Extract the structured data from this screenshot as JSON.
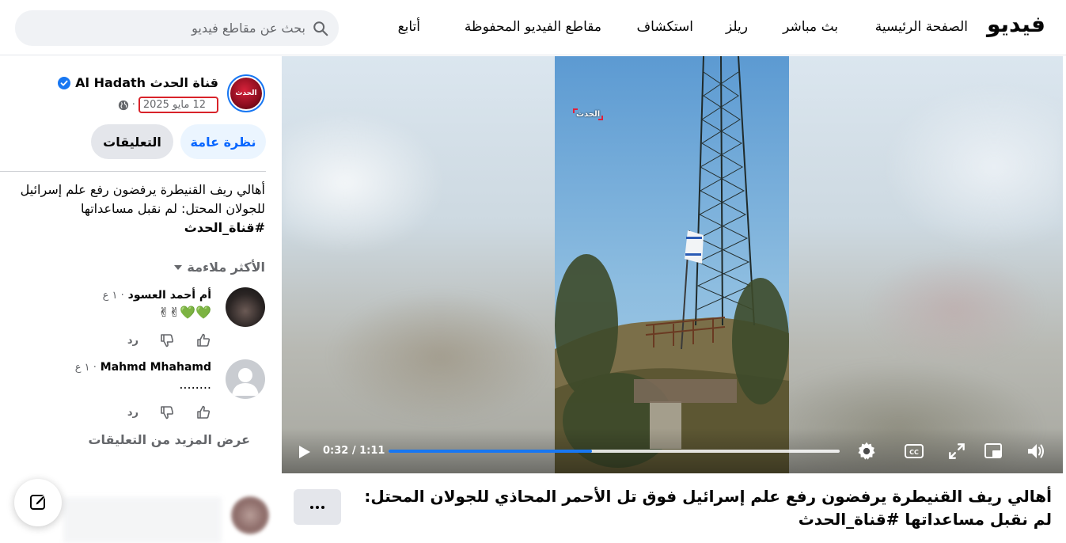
{
  "header": {
    "brand": "فيديو",
    "nav": [
      "الصفحة الرئيسية",
      "بث مباشر",
      "ريلز",
      "استكشاف",
      "مقاطع الفيديو المحفوظة",
      "أتابع"
    ],
    "search_placeholder": "بحث عن مقاطع فيديو"
  },
  "post": {
    "page_name": "قناة الحدث Al Hadath",
    "avatar_text": "الحدث",
    "date": "12 مايو 2025",
    "date_sep": "·",
    "tab_overview": "نظرة عامة",
    "tab_comments": "التعليقات",
    "description_line1": "أهالي ريف القنيطرة يرفضون رفع علم إسرائيل",
    "description_line2": "للجولان المحتل: لم نقبل مساعداتها",
    "description_tag": "#قناة_الحدث",
    "sort_label": "الأكثر ملاءمة"
  },
  "comments": [
    {
      "author": "أم أحمد العسود",
      "time": "· ١ ع",
      "body": "💚💚✌✌",
      "reply": "رد"
    },
    {
      "author": "Mahmd Mhahamd",
      "time": "· ١ ع",
      "body": "........",
      "reply": "رد"
    }
  ],
  "more_comments": "عرض المزيد من التعليقات",
  "video": {
    "watermark": "الحدث",
    "current_time": "0:32",
    "duration": "1:11",
    "time_label": "0:32 / 1:11",
    "progress": 0.45,
    "title": "أهالي ريف القنيطرة يرفضون رفع علم إسرائيل فوق تل الأحمر المحاذي للجولان المحتل: لم نقبل مساعداتها #قناة_الحدث"
  },
  "colors": {
    "accent": "#1877f2",
    "highlight": "#d8232a",
    "overview_bg": "#ebf5ff"
  }
}
